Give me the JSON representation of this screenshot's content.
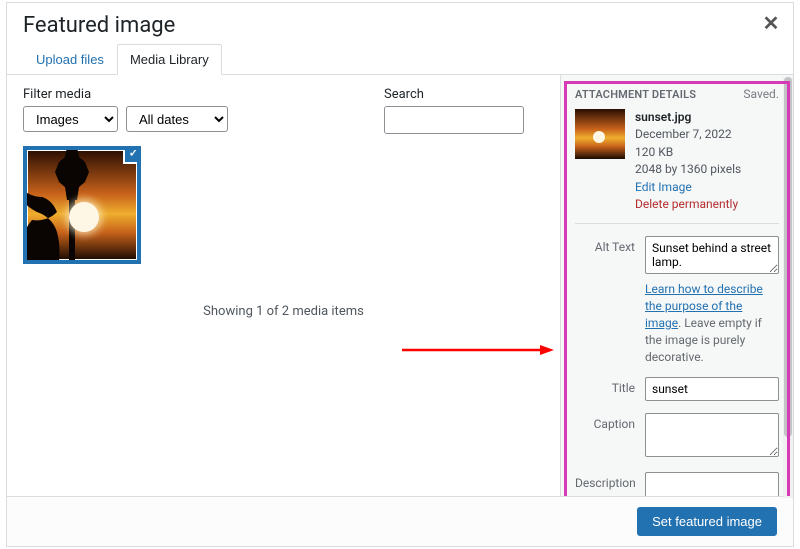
{
  "modal": {
    "title": "Featured image",
    "close_glyph": "✕"
  },
  "tabs": {
    "upload": "Upload files",
    "library": "Media Library"
  },
  "filters": {
    "media_label": "Filter media",
    "media_value": "Images",
    "date_value": "All dates",
    "search_label": "Search"
  },
  "library": {
    "status": "Showing 1 of 2 media items",
    "selected_check": "✓"
  },
  "sidebar": {
    "heading": "ATTACHMENT DETAILS",
    "saved": "Saved.",
    "file": {
      "name": "sunset.jpg",
      "date": "December 7, 2022",
      "size": "120 KB",
      "dimensions": "2048 by 1360 pixels",
      "edit_link": "Edit Image",
      "delete_link": "Delete permanently"
    },
    "fields": {
      "alt_label": "Alt Text",
      "alt_value": "Sunset behind a street lamp.",
      "alt_help_link": "Learn how to describe the purpose of the image",
      "alt_help_tail": ". Leave empty if the image is purely decorative.",
      "title_label": "Title",
      "title_value": "sunset",
      "caption_label": "Caption",
      "caption_value": "",
      "description_label": "Description",
      "description_value": ""
    }
  },
  "footer": {
    "primary": "Set featured image"
  }
}
